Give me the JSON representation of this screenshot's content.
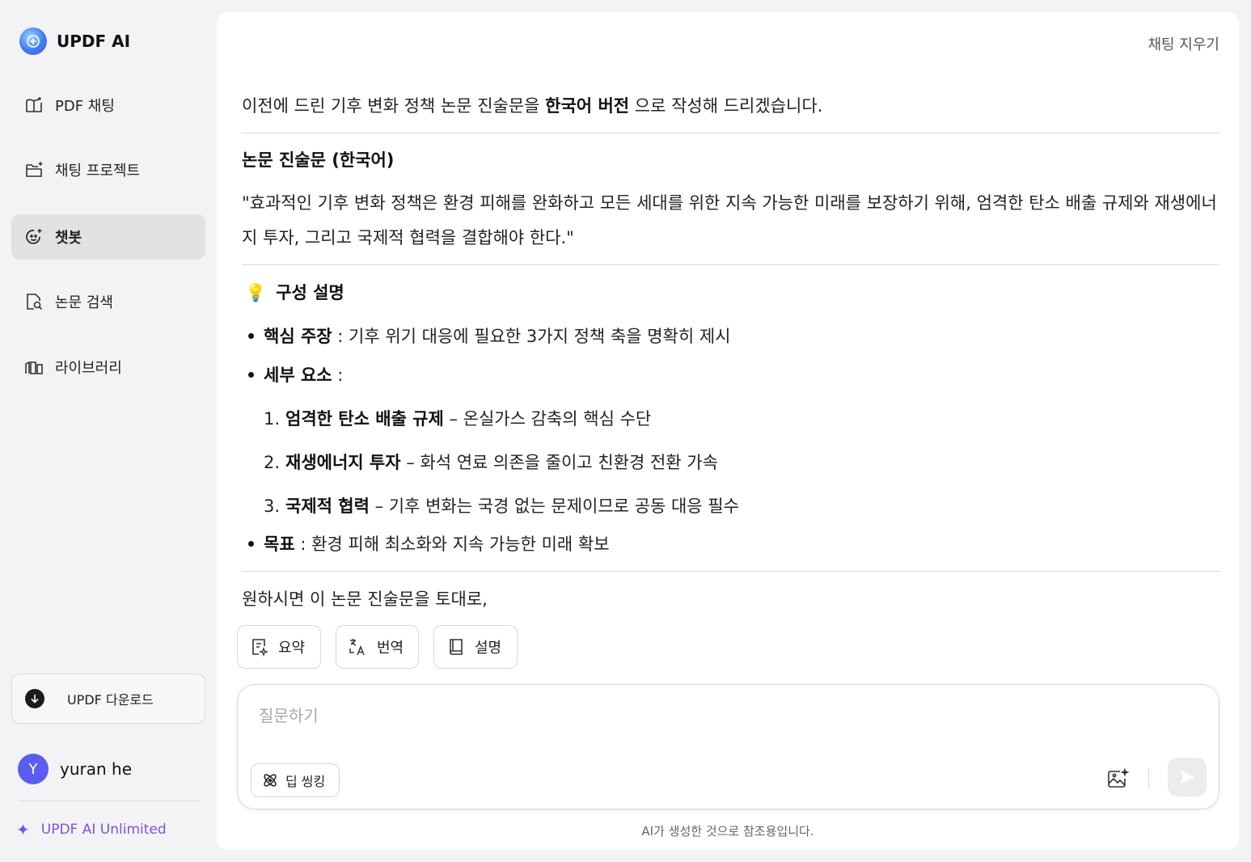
{
  "brand": {
    "name": "UPDF AI"
  },
  "sidebar": {
    "items": [
      {
        "label": "PDF 채팅",
        "icon": "book-sparkle-icon"
      },
      {
        "label": "채팅 프로젝트",
        "icon": "folder-sparkle-icon"
      },
      {
        "label": "챗봇",
        "icon": "chatbot-icon",
        "active": true
      },
      {
        "label": "논문 검색",
        "icon": "paper-search-icon"
      },
      {
        "label": "라이브러리",
        "icon": "library-icon"
      }
    ],
    "download_label": "UPDF 다운로드",
    "user": {
      "initial": "Y",
      "name": "yuran he"
    },
    "unlimited_label": "UPDF AI Unlimited"
  },
  "header": {
    "clear_chat": "채팅 지우기"
  },
  "message": {
    "intro_before": "이전에 드린 기후 변화 정책 논문 진술문을 ",
    "intro_bold": "한국어 버전",
    "intro_after": " 으로 작성해 드리겠습니다.",
    "section_title": "논문 진술문 (한국어)",
    "quote": "\"효과적인 기후 변화 정책은 환경 피해를 완화하고 모든 세대를 위한 지속 가능한 미래를 보장하기 위해, 엄격한 탄소 배출 규제와 재생에너지 투자, 그리고 국제적 협력을 결합해야 한다.\"",
    "structure_emoji": "💡",
    "structure_title": "구성 설명",
    "bullets": [
      {
        "bold": "핵심 주장",
        "text": " : 기후 위기 대응에 필요한 3가지 정책 축을 명확히 제시"
      },
      {
        "bold": "세부 요소",
        "text": " :"
      },
      {
        "bold": "목표",
        "text": " : 환경 피해 최소화와 지속 가능한 미래 확보"
      }
    ],
    "numbered": [
      {
        "num": "1.",
        "bold": "엄격한 탄소 배출 규제",
        "text": " – 온실가스 감축의 핵심 수단"
      },
      {
        "num": "2.",
        "bold": "재생에너지 투자",
        "text": " – 화석 연료 의존을 줄이고 친환경 전환 가속"
      },
      {
        "num": "3.",
        "bold": "국제적 협력",
        "text": " – 기후 변화는 국경 없는 문제이므로 공동 대응 필수"
      }
    ],
    "follow_up": "원하시면 이 논문 진술문을 토대로,"
  },
  "actions": [
    {
      "label": "요약",
      "icon": "summary-icon"
    },
    {
      "label": "번역",
      "icon": "translate-icon"
    },
    {
      "label": "설명",
      "icon": "book-icon"
    }
  ],
  "input": {
    "placeholder": "질문하기",
    "deep_thinking_label": "딥 씽킹"
  },
  "disclaimer": "AI가 생성한 것으로 참조용입니다."
}
